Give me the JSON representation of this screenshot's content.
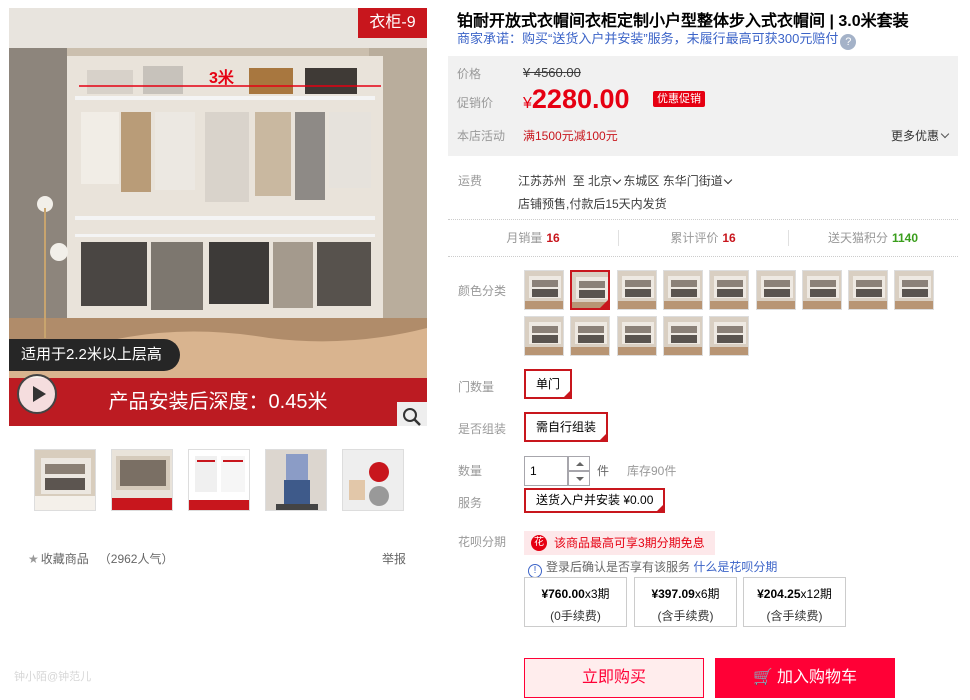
{
  "gallery": {
    "corner_badge": "衣柜-9",
    "dimension_label": "3米",
    "suitable_tag": "适用于2.2米以上层高",
    "depth_caption": "产品安装后深度：0.45米",
    "thumbnails": [
      "thumb-1",
      "thumb-2",
      "thumb-3",
      "thumb-4",
      "thumb-5"
    ]
  },
  "favorite": {
    "label": "收藏商品",
    "count": "（2962人气）"
  },
  "report_label": "举报",
  "watermark": "钟小陌@钟范儿",
  "product": {
    "title": "铂耐开放式衣帽间衣柜定制小户型整体步入式衣帽间 | 3.0米套装",
    "promise": "商家承诺：购买“送货入户并安装”服务，未履行最高可获300元赔付",
    "help_icon": "?"
  },
  "price": {
    "orig_label": "价格",
    "orig_value": "¥ 4560.00",
    "promo_label": "促销价",
    "currency": "¥",
    "promo_value": "2280.00",
    "promo_tag": "优惠促销",
    "activity_label": "本店活动",
    "activity_value": "满1500元减100元",
    "more_promo": "更多优惠"
  },
  "shipping": {
    "label": "运费",
    "from": "江苏苏州",
    "to_word": "至",
    "city": "北京",
    "district": "东城区 东华门街道",
    "note": "店铺预售,付款后15天内发货"
  },
  "stats": [
    {
      "label": "月销量",
      "value": "16"
    },
    {
      "label": "累计评价",
      "value": "16"
    },
    {
      "label": "送天猫积分",
      "value": "1140"
    }
  ],
  "options": {
    "color_label": "颜色分类",
    "color_count": 14,
    "selected_color_index": 1,
    "door_label": "门数量",
    "door_value": "单门",
    "assembly_label": "是否组装",
    "assembly_value": "需自行组装",
    "qty_label": "数量",
    "qty_value": "1",
    "qty_unit": "件",
    "stock": "库存90件",
    "service_label": "服务",
    "service_value": "送货入户并安装 ¥0.00"
  },
  "installment": {
    "label": "花呗分期",
    "banner": "该商品最高可享3期分期免息",
    "login_hint": "登录后确认是否享有该服务",
    "what_is": "什么是花呗分期",
    "plans": [
      {
        "amount": "¥760.00",
        "periods": "x3期",
        "fee": "(0手续费)"
      },
      {
        "amount": "¥397.09",
        "periods": "x6期",
        "fee": "(含手续费)"
      },
      {
        "amount": "¥204.25",
        "periods": "x12期",
        "fee": "(含手续费)"
      }
    ]
  },
  "actions": {
    "buy_now": "立即购买",
    "add_to_cart": "加入购物车"
  },
  "colors": {
    "accent": "#c8161d",
    "tmall_red": "#ff0036",
    "link_blue": "#3c64c8",
    "points_green": "#3a9e1c"
  }
}
